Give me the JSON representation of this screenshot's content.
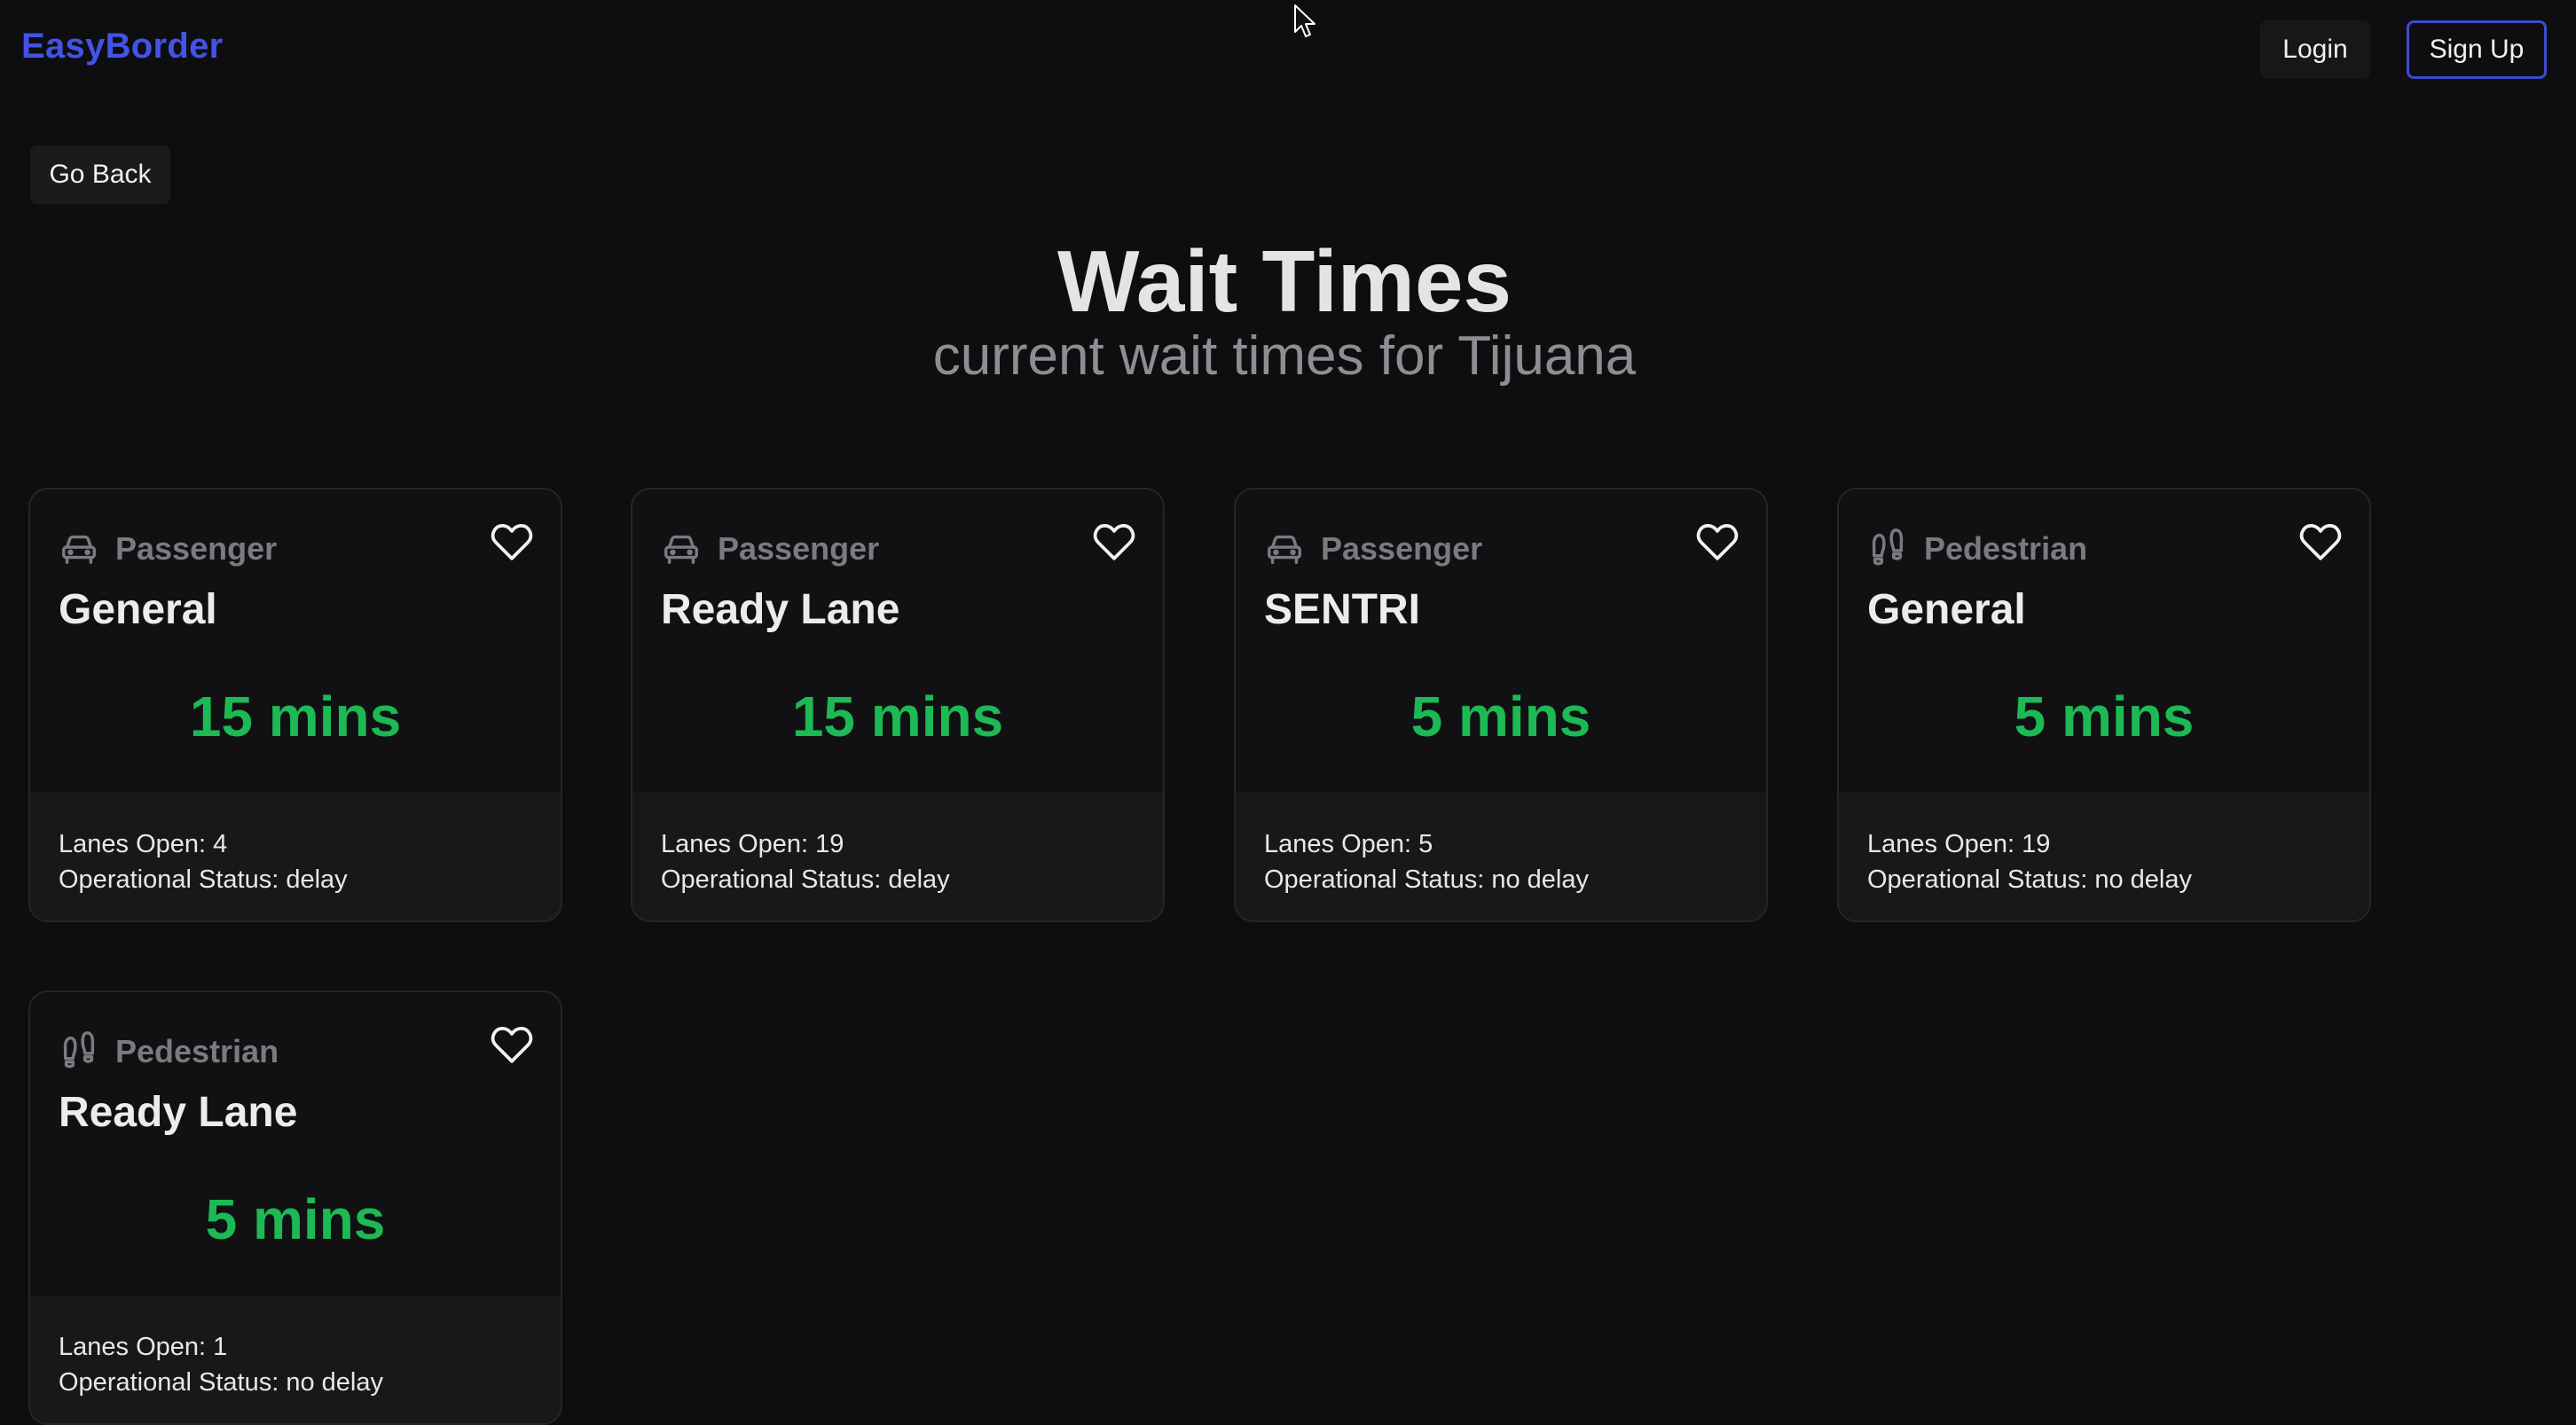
{
  "brand": "EasyBorder",
  "nav": {
    "login_label": "Login",
    "signup_label": "Sign Up"
  },
  "go_back_label": "Go Back",
  "header": {
    "title": "Wait Times",
    "subtitle": "current wait times for Tijuana"
  },
  "cards": [
    {
      "type_label": "Passenger",
      "type_icon": "car-icon",
      "lane": "General",
      "wait": "15 mins",
      "lanes_open": "Lanes Open: 4",
      "status": "Operational Status: delay"
    },
    {
      "type_label": "Passenger",
      "type_icon": "car-icon",
      "lane": "Ready Lane",
      "wait": "15 mins",
      "lanes_open": "Lanes Open: 19",
      "status": "Operational Status: delay"
    },
    {
      "type_label": "Passenger",
      "type_icon": "car-icon",
      "lane": "SENTRI",
      "wait": "5 mins",
      "lanes_open": "Lanes Open: 5",
      "status": "Operational Status: no delay"
    },
    {
      "type_label": "Pedestrian",
      "type_icon": "footprints-icon",
      "lane": "General",
      "wait": "5 mins",
      "lanes_open": "Lanes Open: 19",
      "status": "Operational Status: no delay"
    },
    {
      "type_label": "Pedestrian",
      "type_icon": "footprints-icon",
      "lane": "Ready Lane",
      "wait": "5 mins",
      "lanes_open": "Lanes Open: 1",
      "status": "Operational Status: no delay"
    }
  ],
  "colors": {
    "background": "#0e0e11",
    "brand": "#4353e8",
    "wait_time": "#1db954",
    "signup_border": "#3d4cc9"
  }
}
